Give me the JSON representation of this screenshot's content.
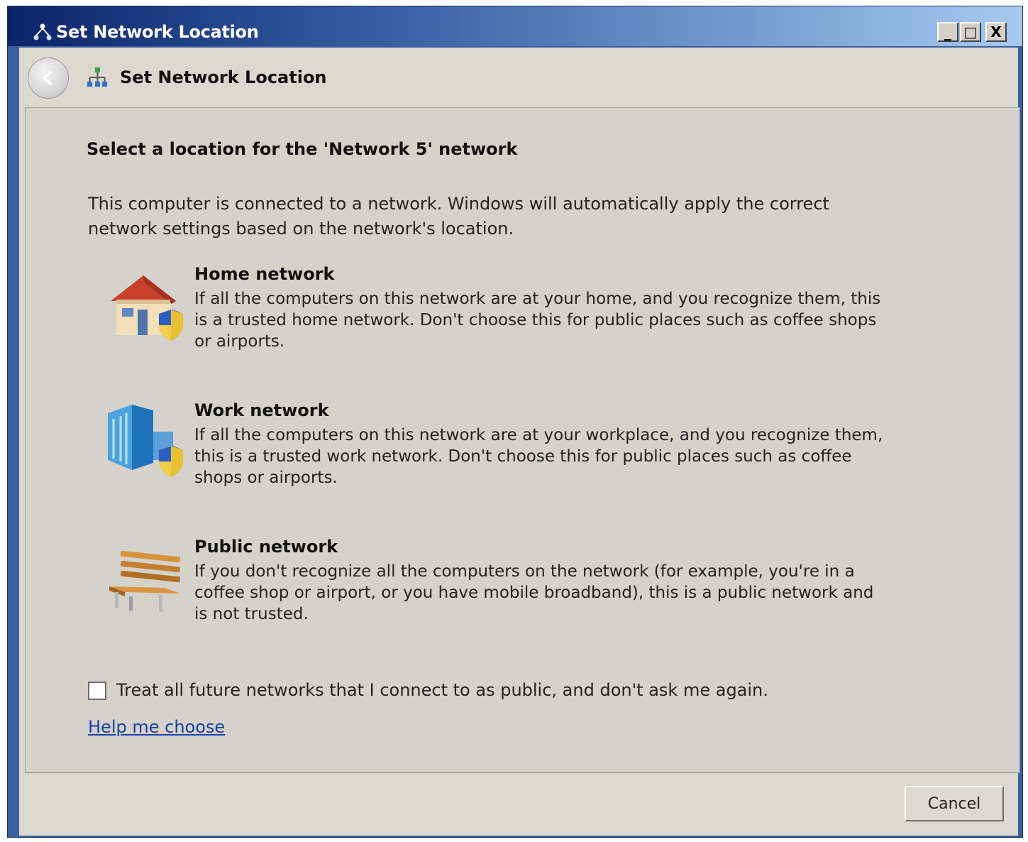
{
  "window": {
    "title": "Set Network Location",
    "controls": {
      "minimize": "_",
      "maximize": "□",
      "close": "X"
    }
  },
  "header": {
    "title": "Set Network Location",
    "back_icon": "back-arrow-icon",
    "network_icon": "network-icon"
  },
  "content": {
    "heading": "Select a location for the 'Network  5' network",
    "intro": "This computer is connected to a network. Windows will automatically apply the correct network settings based on the network's location.",
    "options": [
      {
        "title": "Home network",
        "description": "If all the computers on this network are at your home, and you recognize them, this is a trusted home network.  Don't choose this for public places such as coffee shops or airports.",
        "icon": "house-icon"
      },
      {
        "title": "Work network",
        "description": "If all the computers on this network are at your workplace, and you recognize them, this is a trusted work network.  Don't choose this for public places such as coffee shops or airports.",
        "icon": "office-building-icon"
      },
      {
        "title": "Public network",
        "description": "If you don't recognize all the computers on the network (for example, you're in a coffee shop or airport, or you have mobile broadband), this is a public network and is not trusted.",
        "icon": "park-bench-icon"
      }
    ],
    "checkbox": {
      "label": "Treat all future networks that I connect to as public, and don't ask me again.",
      "checked": false
    },
    "help_link": "Help me choose"
  },
  "footer": {
    "cancel_label": "Cancel"
  },
  "colors": {
    "titlebar_start": "#0a246a",
    "titlebar_end": "#a6caf0",
    "dialog_bg": "#d5d2cb",
    "link": "#1a3ea8"
  }
}
